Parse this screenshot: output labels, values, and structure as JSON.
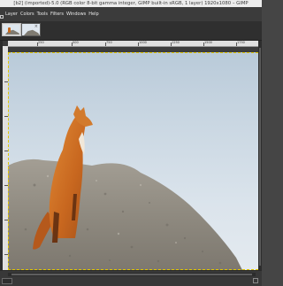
{
  "window": {
    "title": "[b2] (imported)-5.0 (RGB color 8-bit gamma integer, GIMP built-in sRGB, 1 layer) 1920x1080 – GIMP"
  },
  "menubar": {
    "items": [
      "Layer",
      "Colors",
      "Tools",
      "Filters",
      "Windows",
      "Help"
    ]
  },
  "image_tabs": [
    {
      "name": "image-tab-active"
    },
    {
      "name": "image-tab-2",
      "close_glyph": "×"
    }
  ],
  "rulers": {
    "top_labels": [
      "250",
      "500",
      "750",
      "1000",
      "1250",
      "1500",
      "1750"
    ]
  },
  "colors": {
    "menubar_bg": "#3b3b3b",
    "canvas_bg": "#3c3c3c",
    "layer_boundary": "#e1c600",
    "fox_fur": "#c8671f"
  },
  "icons": {
    "close": "close-icon",
    "navigate": "navigate-icon"
  }
}
